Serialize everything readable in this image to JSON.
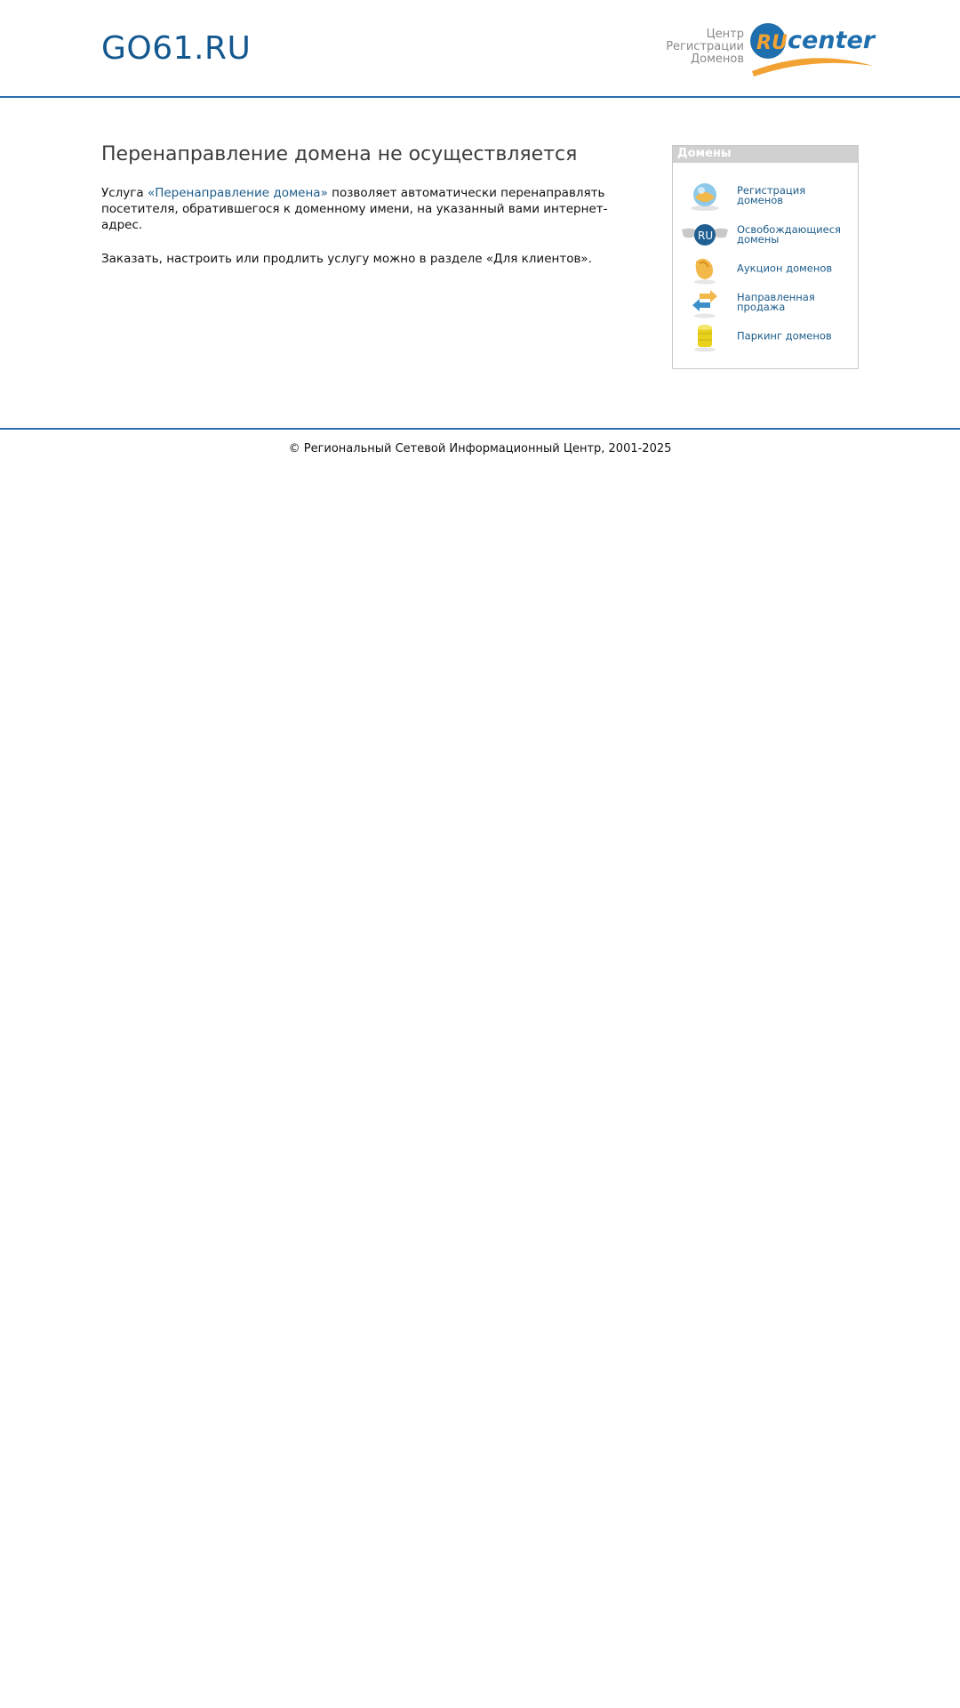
{
  "header": {
    "domain": "GO61.RU",
    "registrar": {
      "line1": "Центр",
      "line2": "Регистрации",
      "line3": "Доменов",
      "logo_ru": "RU",
      "logo_center": "center"
    }
  },
  "main": {
    "heading": "Перенаправление домена не осуществляется",
    "para1_prefix": "Услуга ",
    "para1_link": "«Перенаправление домена»",
    "para1_suffix": " позволяет автоматически перенаправлять посетителя, обратившегося к доменному имени, на указанный вами интернет-адрес.",
    "para2": "Заказать, настроить или продлить услугу можно в разделе «Для клиентов»."
  },
  "sidebar": {
    "title": "Домены",
    "items": [
      {
        "label_line1": "Регистрация",
        "label_line2": "доменов",
        "icon": "globe-icon"
      },
      {
        "label_line1": "Освобождающиеся",
        "label_line2": "домены",
        "icon": "ru-wings-icon",
        "icon_text": "RU"
      },
      {
        "label_line1": "Аукцион доменов",
        "label_line2": "",
        "icon": "auction-icon"
      },
      {
        "label_line1": "Направленная",
        "label_line2": "продажа",
        "icon": "arrows-icon"
      },
      {
        "label_line1": "Паркинг доменов",
        "label_line2": "",
        "icon": "coins-icon"
      }
    ]
  },
  "footer": {
    "copyright": "© Региональный Сетевой Информационный Центр, 2001-2025"
  },
  "colors": {
    "accent_line": "#2a6fb0",
    "title_blue": "#14588f",
    "link_blue": "#1b5c8b",
    "logo_orange": "#f2a233"
  }
}
